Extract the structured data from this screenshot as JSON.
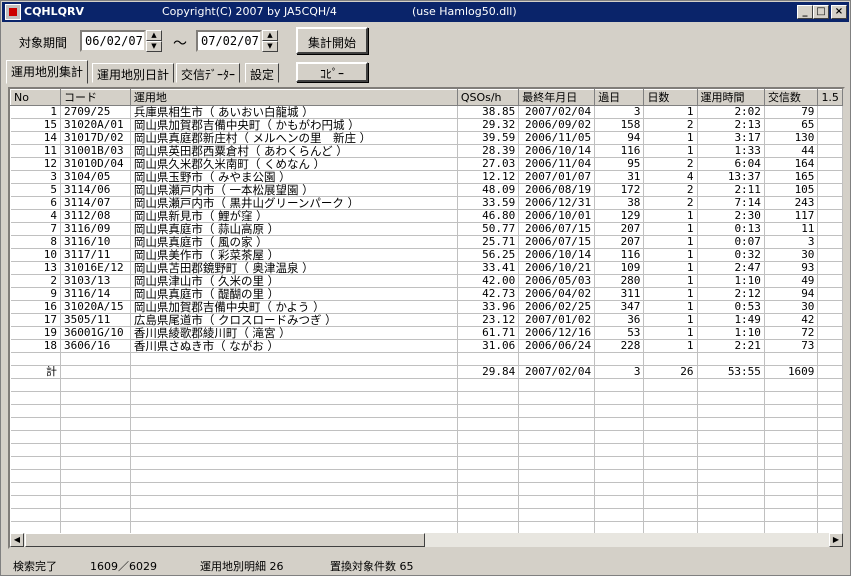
{
  "window": {
    "app_name": "CQHLQRV",
    "copyright": "Copyright(C) 2007  by JA5CQH/4",
    "note": "(use Hamlog50.dll)",
    "minimize": "_",
    "maximize": "□",
    "close": "×"
  },
  "period": {
    "label": "対象期間",
    "from": "06/02/07",
    "tilde": "〜",
    "to": "07/02/07",
    "up": "▲",
    "down": "▼"
  },
  "buttons": {
    "aggregate": "集計開始",
    "copy": "ｺﾋﾟｰ"
  },
  "tabs": [
    "運用地別集計",
    "運用地別日計",
    "交信ﾃﾞｰﾀｰ",
    "設定"
  ],
  "table": {
    "headers": [
      "No",
      "コード",
      "運用地",
      "QSOs/h",
      "最終年月日",
      "過日",
      "日数",
      "運用時間",
      "交信数",
      "1.5"
    ],
    "rows": [
      [
        "1",
        "2709/25",
        "兵庫県相生市（ あいおい白龍城 ）",
        "38.85",
        "2007/02/04",
        "3",
        "1",
        "2:02",
        "79",
        ""
      ],
      [
        "15",
        "31020A/01",
        "岡山県加賀郡吉備中央町（ かもがわ円城 ）",
        "29.32",
        "2006/09/02",
        "158",
        "2",
        "2:13",
        "65",
        ""
      ],
      [
        "14",
        "31017D/02",
        "岡山県真庭郡新庄村（ メルヘンの里　新庄 ）",
        "39.59",
        "2006/11/05",
        "94",
        "1",
        "3:17",
        "130",
        ""
      ],
      [
        "11",
        "31001B/03",
        "岡山県英田郡西粟倉村（ あわくらんど ）",
        "28.39",
        "2006/10/14",
        "116",
        "1",
        "1:33",
        "44",
        ""
      ],
      [
        "12",
        "31010D/04",
        "岡山県久米郡久米南町（ くめなん ）",
        "27.03",
        "2006/11/04",
        "95",
        "2",
        "6:04",
        "164",
        ""
      ],
      [
        "3",
        "3104/05",
        "岡山県玉野市（ みやま公園 ）",
        "12.12",
        "2007/01/07",
        "31",
        "4",
        "13:37",
        "165",
        ""
      ],
      [
        "5",
        "3114/06",
        "岡山県瀬戸内市（ 一本松展望園 ）",
        "48.09",
        "2006/08/19",
        "172",
        "2",
        "2:11",
        "105",
        ""
      ],
      [
        "6",
        "3114/07",
        "岡山県瀬戸内市（ 黒井山グリーンパーク ）",
        "33.59",
        "2006/12/31",
        "38",
        "2",
        "7:14",
        "243",
        ""
      ],
      [
        "4",
        "3112/08",
        "岡山県新見市（ 鯉が窪 ）",
        "46.80",
        "2006/10/01",
        "129",
        "1",
        "2:30",
        "117",
        ""
      ],
      [
        "7",
        "3116/09",
        "岡山県真庭市（ 蒜山高原 ）",
        "50.77",
        "2006/07/15",
        "207",
        "1",
        "0:13",
        "11",
        ""
      ],
      [
        "8",
        "3116/10",
        "岡山県真庭市（ 風の家 ）",
        "25.71",
        "2006/07/15",
        "207",
        "1",
        "0:07",
        "3",
        ""
      ],
      [
        "10",
        "3117/11",
        "岡山県美作市（ 彩菜茶屋 ）",
        "56.25",
        "2006/10/14",
        "116",
        "1",
        "0:32",
        "30",
        ""
      ],
      [
        "13",
        "31016E/12",
        "岡山県苫田郡鏡野町（ 奥津温泉 ）",
        "33.41",
        "2006/10/21",
        "109",
        "1",
        "2:47",
        "93",
        ""
      ],
      [
        "2",
        "3103/13",
        "岡山県津山市（ 久米の里 ）",
        "42.00",
        "2006/05/03",
        "280",
        "1",
        "1:10",
        "49",
        ""
      ],
      [
        "9",
        "3116/14",
        "岡山県真庭市（ 醍醐の里 ）",
        "42.73",
        "2006/04/02",
        "311",
        "1",
        "2:12",
        "94",
        ""
      ],
      [
        "16",
        "31020A/15",
        "岡山県加賀郡吉備中央町（ かよう ）",
        "33.96",
        "2006/02/25",
        "347",
        "1",
        "0:53",
        "30",
        ""
      ],
      [
        "17",
        "3505/11",
        "広島県尾道市（ クロスロードみつぎ ）",
        "23.12",
        "2007/01/02",
        "36",
        "1",
        "1:49",
        "42",
        ""
      ],
      [
        "19",
        "36001G/10",
        "香川県綾歌郡綾川町（ 滝宮 ）",
        "61.71",
        "2006/12/16",
        "53",
        "1",
        "1:10",
        "72",
        ""
      ],
      [
        "18",
        "3606/16",
        "香川県さぬき市（ ながお ）",
        "31.06",
        "2006/06/24",
        "228",
        "1",
        "2:21",
        "73",
        ""
      ]
    ],
    "total": [
      "計",
      "",
      "",
      "29.84",
      "2007/02/04",
      "3",
      "26",
      "53:55",
      "1609",
      ""
    ]
  },
  "scroll": {
    "left": "◀",
    "right": "▶"
  },
  "status": {
    "state": "検索完了",
    "count": "1609／6029",
    "detail": "運用地別明細 26",
    "replace": "置換対象件数 65"
  }
}
